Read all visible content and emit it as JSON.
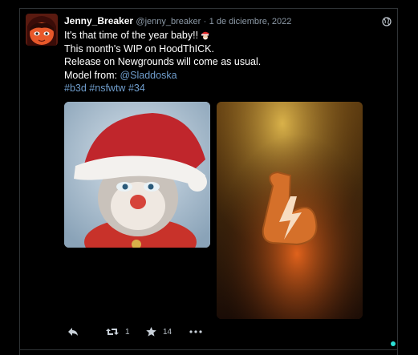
{
  "tweet": {
    "display_name": "Jenny_Breaker",
    "handle": "@jenny_breaker",
    "separator": "·",
    "date": "1 de diciembre, 2022",
    "line1": "It's that time of the year baby!!",
    "line2": "This month's WIP on HoodThICK.",
    "line3": "Release on Newgrounds will come as usual.",
    "line4_prefix": "Model from: ",
    "mention": "@Sladdoska",
    "hashtags": [
      "#b3d",
      "#nsfwtw",
      "#34"
    ]
  },
  "actions": {
    "reply_icon": "reply-icon",
    "retweet_icon": "retweet-icon",
    "retweets": "1",
    "like_icon": "star-icon",
    "likes": "14",
    "more_icon": "more-icon"
  },
  "colors": {
    "background": "#000000",
    "link": "#6f9dcc",
    "muted": "#8b98a5",
    "status_dot": "#2de0d6"
  }
}
